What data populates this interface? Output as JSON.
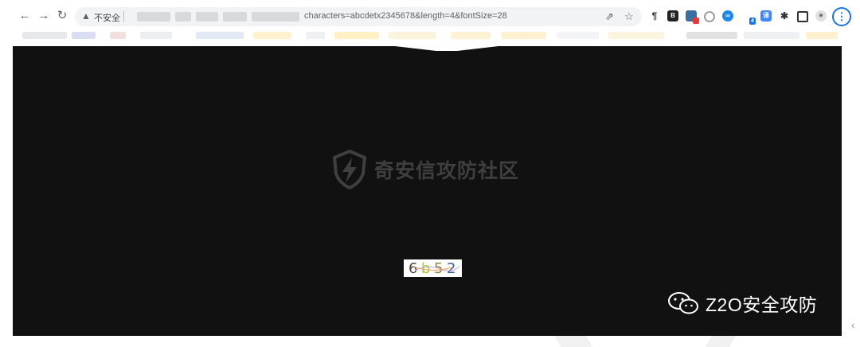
{
  "browser": {
    "security_label": "不安全",
    "url_visible": "characters=abcdetx2345678&length=4&fontSize=28",
    "ext_badge": "4",
    "ext_label": "译"
  },
  "watermark": {
    "text": "奇安信攻防社区"
  },
  "captcha": {
    "chars": [
      "6",
      "b",
      "5",
      "2"
    ],
    "colors": [
      "#4a4a4a",
      "#9acd32",
      "#8b8b3a",
      "#3f5f8f"
    ]
  },
  "brand": {
    "text": "Z2O安全攻防"
  },
  "colors": {
    "viewport_bg": "#111111",
    "omnibox_bg": "#f1f3f4",
    "account_accent": "#1a73e8"
  }
}
